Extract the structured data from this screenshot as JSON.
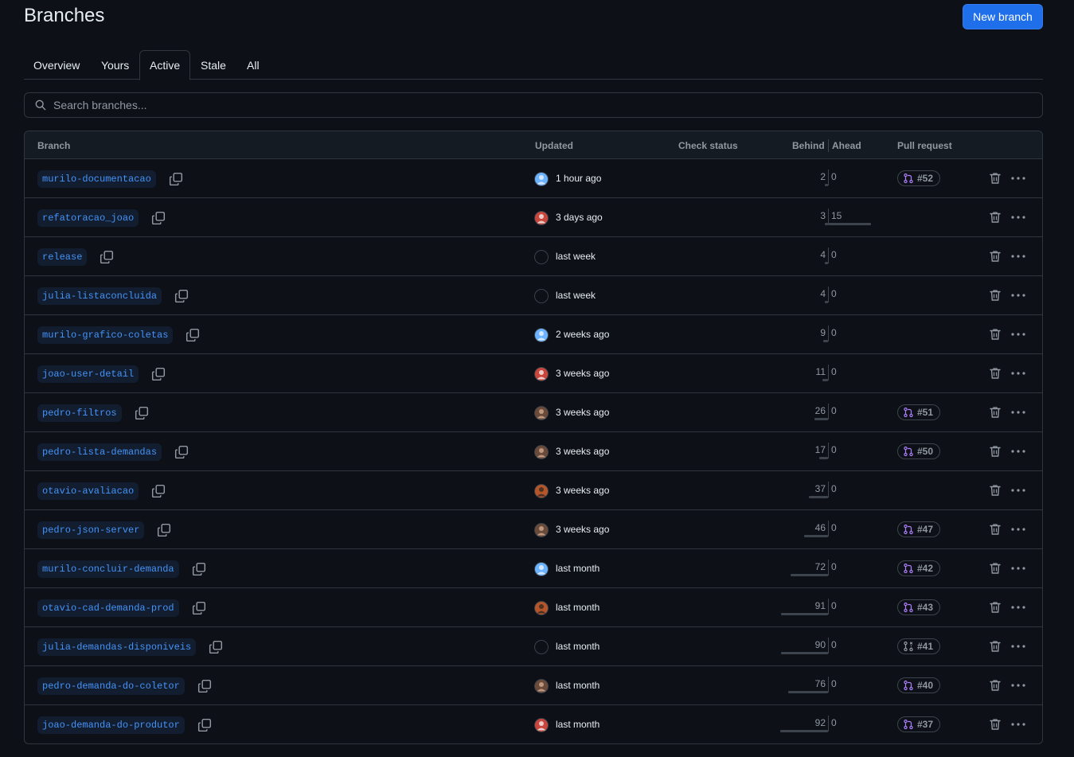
{
  "header": {
    "title": "Branches",
    "new_branch_label": "New branch"
  },
  "tabs": [
    {
      "label": "Overview",
      "selected": false
    },
    {
      "label": "Yours",
      "selected": false
    },
    {
      "label": "Active",
      "selected": true
    },
    {
      "label": "Stale",
      "selected": false
    },
    {
      "label": "All",
      "selected": false
    }
  ],
  "search": {
    "placeholder": "Search branches..."
  },
  "table": {
    "columns": {
      "branch": "Branch",
      "updated": "Updated",
      "check_status": "Check status",
      "behind": "Behind",
      "ahead": "Ahead",
      "pull_request": "Pull request"
    },
    "rows": [
      {
        "name": "murilo-documentacao",
        "avatar": "blue",
        "updated": "1 hour ago",
        "behind": "2",
        "ahead": "0",
        "pr": "#52",
        "pr_state": "open"
      },
      {
        "name": "refatoracao_joao",
        "avatar": "red",
        "updated": "3 days ago",
        "behind": "3",
        "ahead": "15",
        "pr": "",
        "pr_state": ""
      },
      {
        "name": "release",
        "avatar": "dark",
        "updated": "last week",
        "behind": "4",
        "ahead": "0",
        "pr": "",
        "pr_state": ""
      },
      {
        "name": "julia-listaconcluida",
        "avatar": "dark",
        "updated": "last week",
        "behind": "4",
        "ahead": "0",
        "pr": "",
        "pr_state": ""
      },
      {
        "name": "murilo-grafico-coletas",
        "avatar": "blue",
        "updated": "2 weeks ago",
        "behind": "9",
        "ahead": "0",
        "pr": "",
        "pr_state": ""
      },
      {
        "name": "joao-user-detail",
        "avatar": "red",
        "updated": "3 weeks ago",
        "behind": "11",
        "ahead": "0",
        "pr": "",
        "pr_state": ""
      },
      {
        "name": "pedro-filtros",
        "avatar": "brown",
        "updated": "3 weeks ago",
        "behind": "26",
        "ahead": "0",
        "pr": "#51",
        "pr_state": "open"
      },
      {
        "name": "pedro-lista-demandas",
        "avatar": "brown",
        "updated": "3 weeks ago",
        "behind": "17",
        "ahead": "0",
        "pr": "#50",
        "pr_state": "open"
      },
      {
        "name": "otavio-avaliacao",
        "avatar": "orange",
        "updated": "3 weeks ago",
        "behind": "37",
        "ahead": "0",
        "pr": "",
        "pr_state": ""
      },
      {
        "name": "pedro-json-server",
        "avatar": "brown",
        "updated": "3 weeks ago",
        "behind": "46",
        "ahead": "0",
        "pr": "#47",
        "pr_state": "open"
      },
      {
        "name": "murilo-concluir-demanda",
        "avatar": "blue",
        "updated": "last month",
        "behind": "72",
        "ahead": "0",
        "pr": "#42",
        "pr_state": "open"
      },
      {
        "name": "otavio-cad-demanda-prod",
        "avatar": "orange",
        "updated": "last month",
        "behind": "91",
        "ahead": "0",
        "pr": "#43",
        "pr_state": "open"
      },
      {
        "name": "julia-demandas-disponiveis",
        "avatar": "dark",
        "updated": "last month",
        "behind": "90",
        "ahead": "0",
        "pr": "#41",
        "pr_state": "closed"
      },
      {
        "name": "pedro-demanda-do-coletor",
        "avatar": "brown",
        "updated": "last month",
        "behind": "76",
        "ahead": "0",
        "pr": "#40",
        "pr_state": "open"
      },
      {
        "name": "joao-demanda-do-produtor",
        "avatar": "red",
        "updated": "last month",
        "behind": "92",
        "ahead": "0",
        "pr": "#37",
        "pr_state": "open"
      }
    ]
  },
  "colors": {
    "background": "#0d1117",
    "accent": "#1f6feb",
    "link": "#4493f8",
    "border": "#30363d",
    "pr_open": "#ab7df8",
    "muted": "#9198a1"
  },
  "icons": {
    "search": "search-icon",
    "copy": "copy-icon",
    "pr_open": "git-pull-request-icon",
    "pr_closed": "git-pull-request-closed-icon",
    "delete": "trash-icon",
    "more": "kebab-horizontal-icon"
  }
}
